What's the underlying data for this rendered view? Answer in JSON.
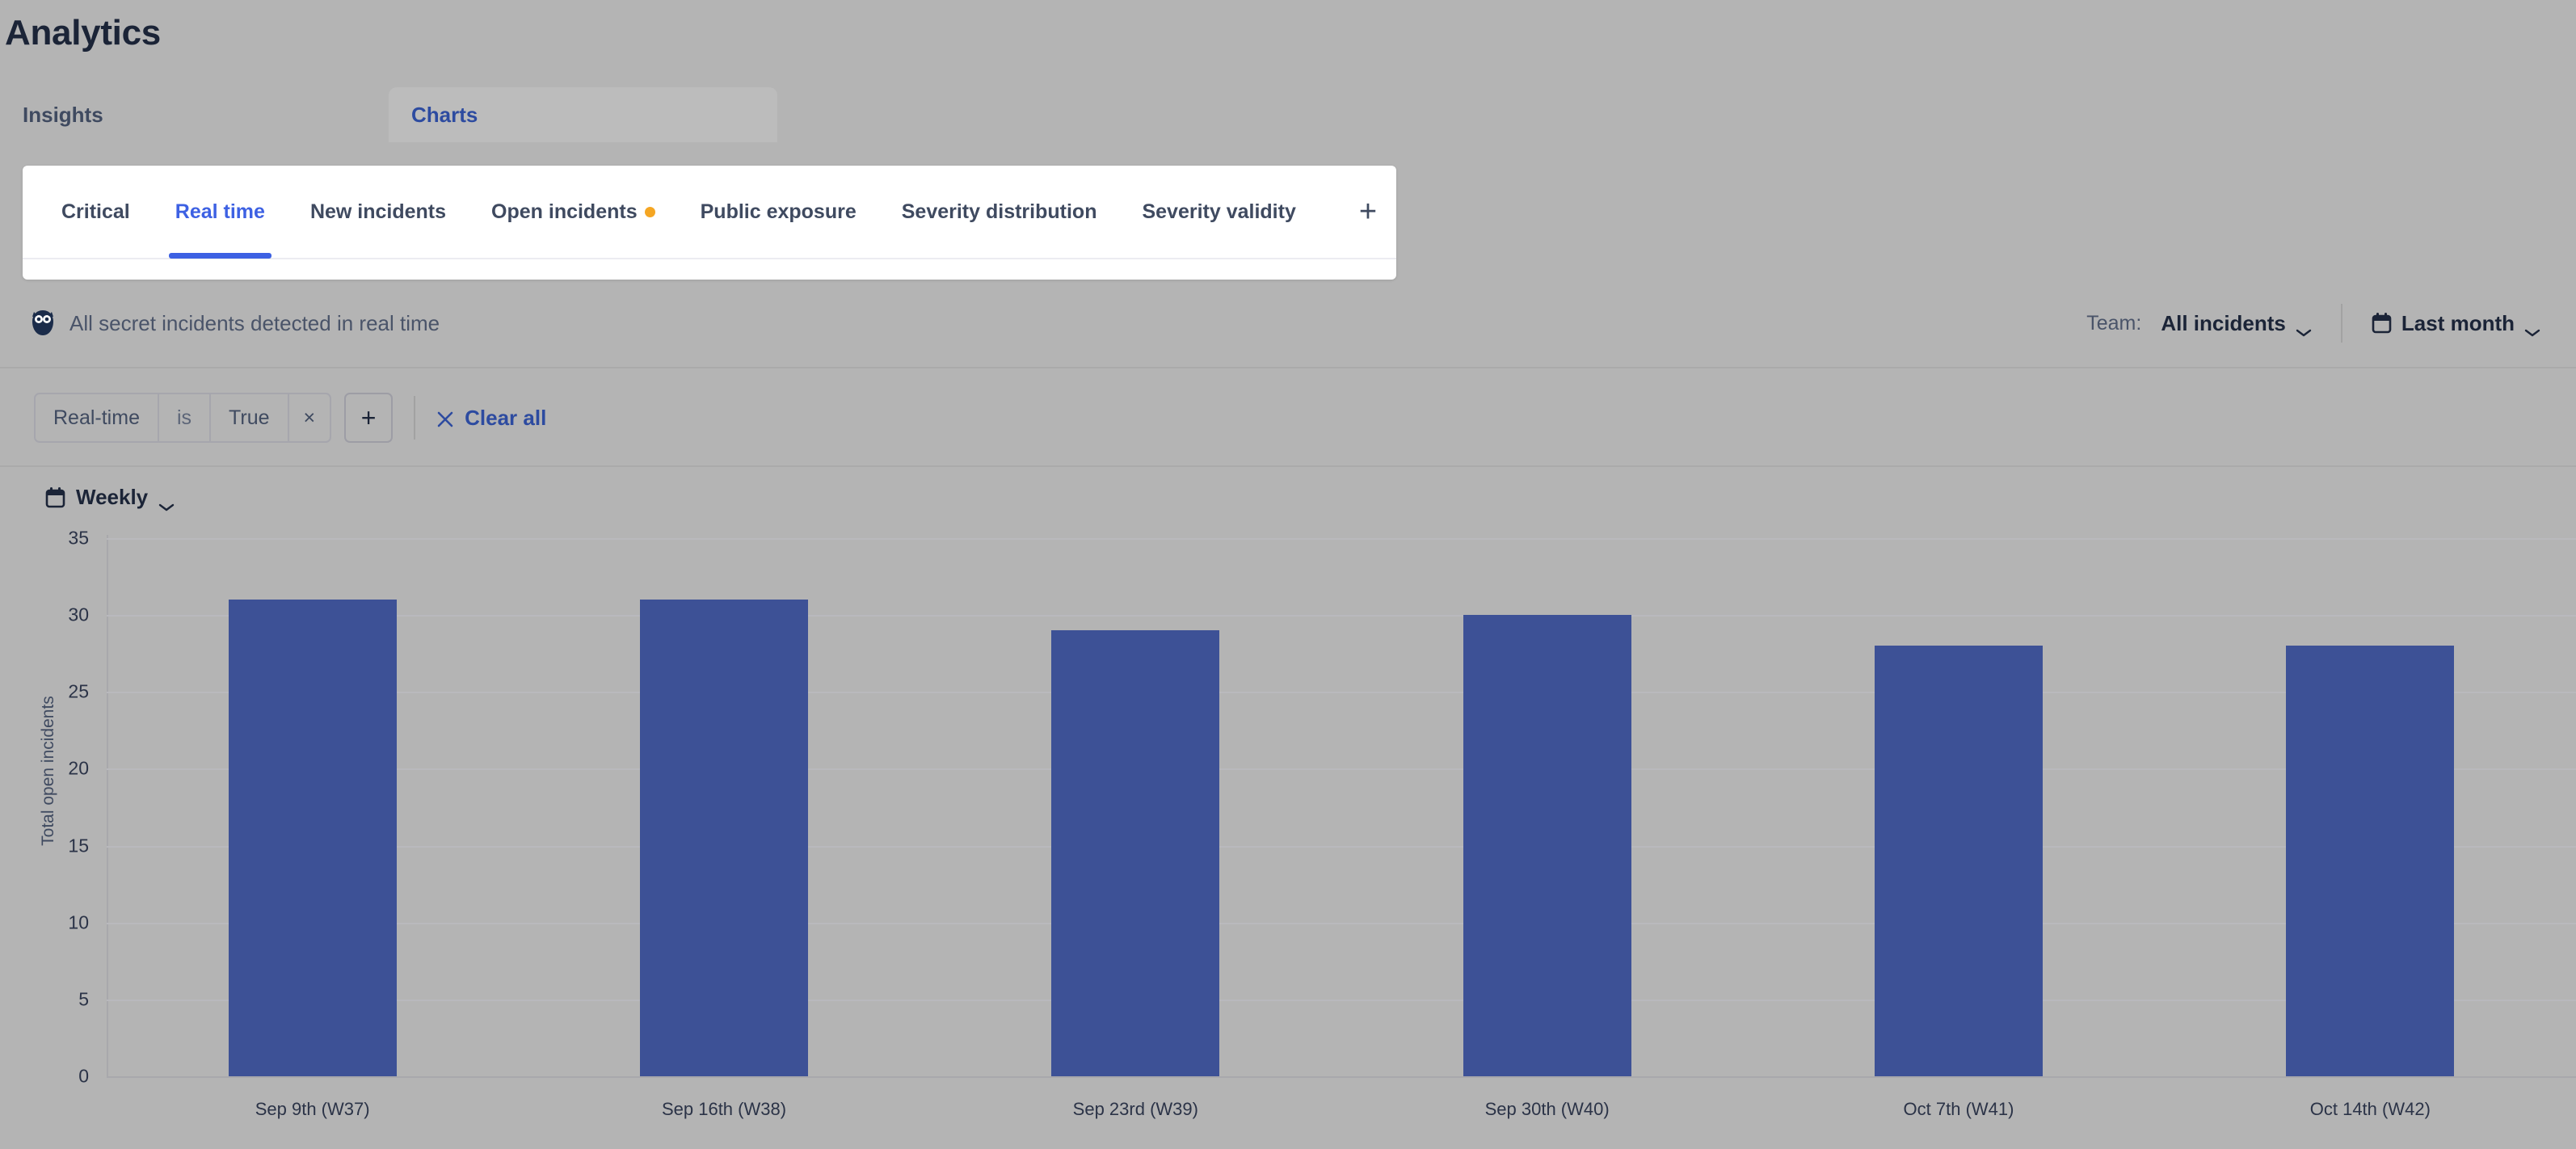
{
  "page": {
    "title": "Analytics"
  },
  "toplevel_tabs": [
    {
      "label": "Insights",
      "active": false
    },
    {
      "label": "Charts",
      "active": true
    }
  ],
  "chart_tabs": {
    "items": [
      {
        "label": "Critical",
        "active": false,
        "dot": false
      },
      {
        "label": "Real time",
        "active": true,
        "dot": false
      },
      {
        "label": "New incidents",
        "active": false,
        "dot": false
      },
      {
        "label": "Open incidents",
        "active": false,
        "dot": true
      },
      {
        "label": "Public exposure",
        "active": false,
        "dot": false
      },
      {
        "label": "Severity distribution",
        "active": false,
        "dot": false
      },
      {
        "label": "Severity validity",
        "active": false,
        "dot": false
      }
    ],
    "add_label": "+",
    "dot_color": "#f5a623",
    "active_color": "#3d61e3"
  },
  "subtitle": {
    "icon": "owl-icon",
    "text": "All secret incidents detected in real time",
    "team_label": "Team:",
    "team_value": "All incidents",
    "date_range": "Last month"
  },
  "filters": {
    "chip": {
      "key": "Real-time",
      "operator": "is",
      "value": "True",
      "remove": "×"
    },
    "add_label": "+",
    "clear_all": "Clear all"
  },
  "granularity": {
    "value": "Weekly"
  },
  "chart_data": {
    "type": "bar",
    "title": "",
    "xlabel": "",
    "ylabel": "Total open incidents",
    "categories": [
      "Sep 9th (W37)",
      "Sep 16th (W38)",
      "Sep 23rd (W39)",
      "Sep 30th (W40)",
      "Oct 7th (W41)",
      "Oct 14th (W42)"
    ],
    "values": [
      31,
      31,
      29,
      30,
      28,
      28
    ],
    "ylim": [
      0,
      35
    ],
    "yticks": [
      0,
      5,
      10,
      15,
      20,
      25,
      30,
      35
    ],
    "grid": true,
    "legend": false,
    "bar_color": "#3d5196",
    "series": [
      {
        "name": "Total open incidents",
        "values": [
          31,
          31,
          29,
          30,
          28,
          28
        ]
      }
    ]
  }
}
